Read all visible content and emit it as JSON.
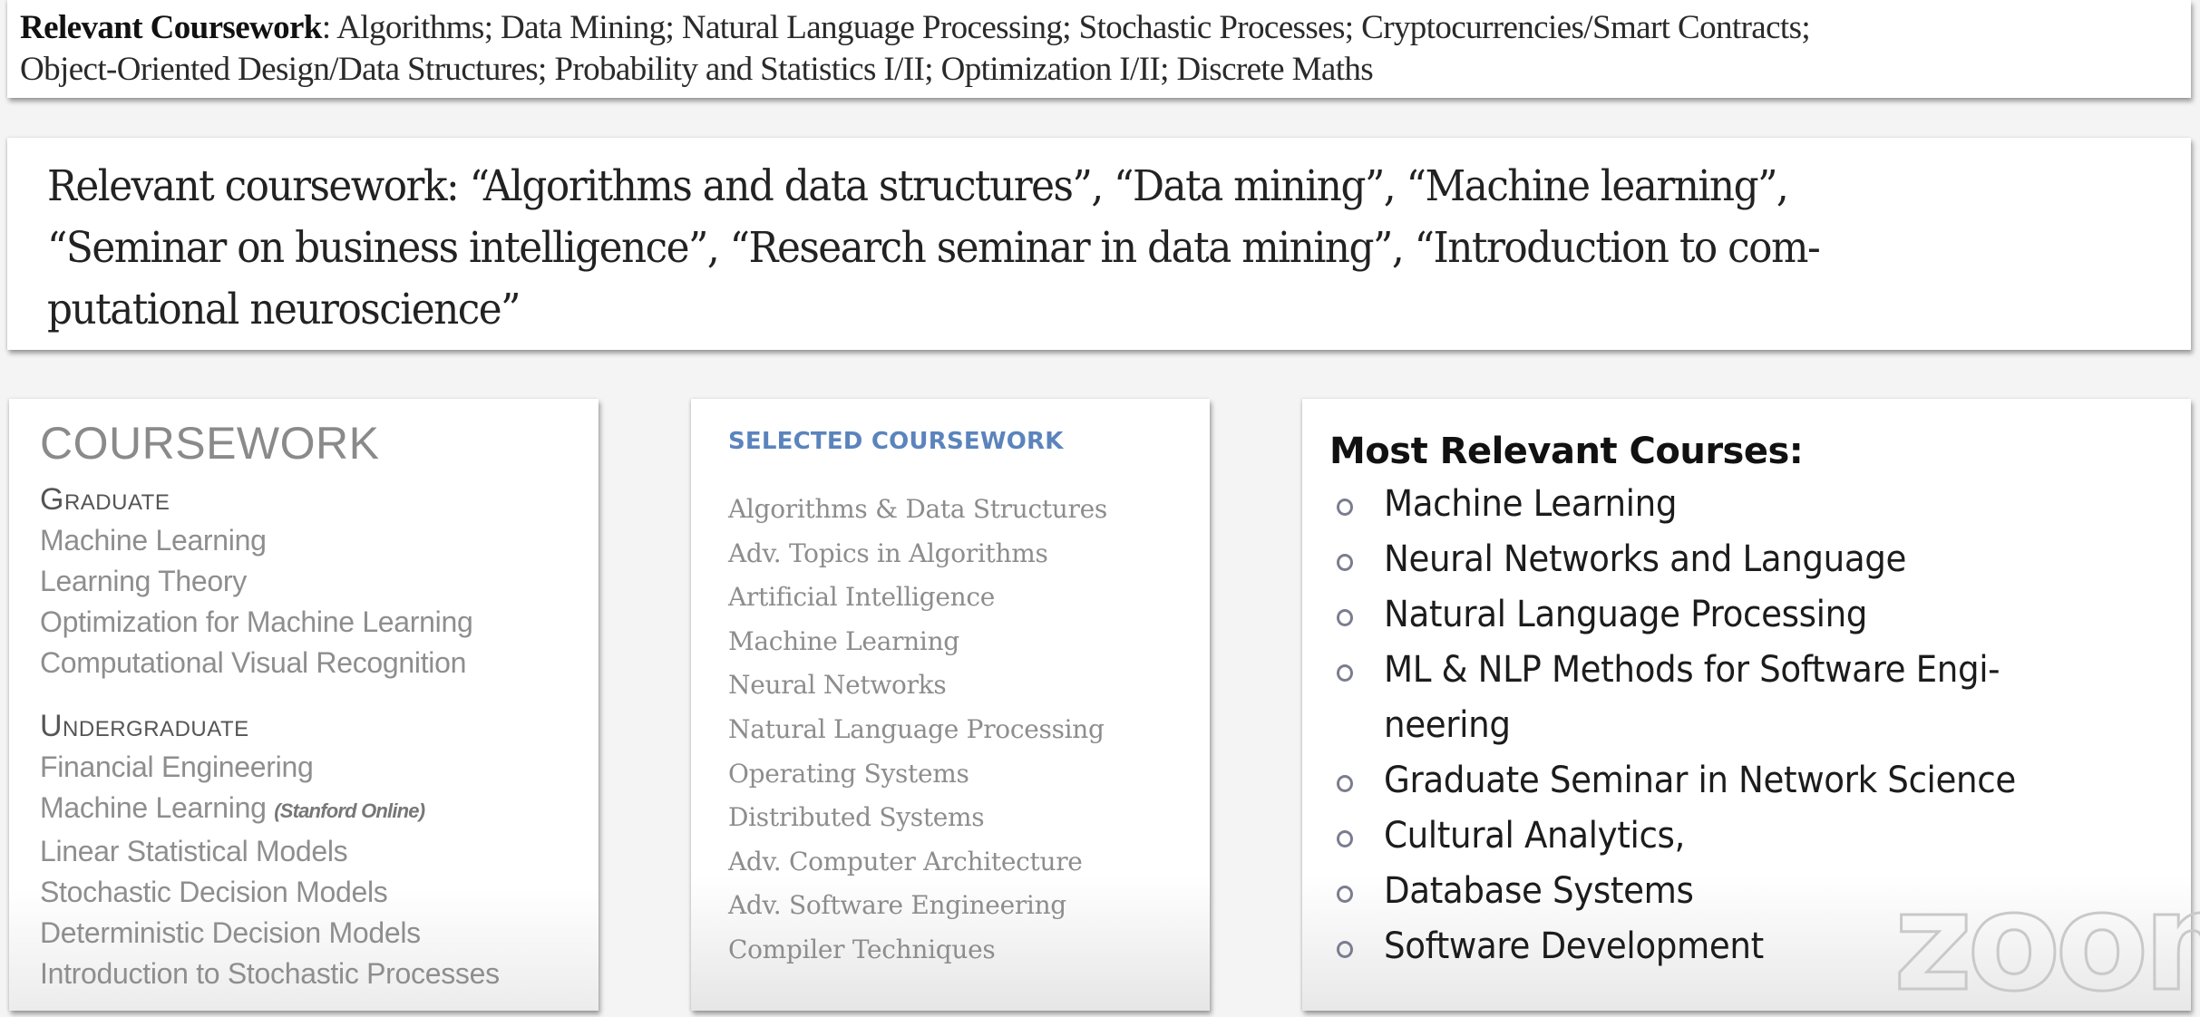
{
  "card_1": {
    "lead": "Relevant Coursework",
    "line_1_rest": ": Algorithms; Data Mining; Natural Language Processing; Stochastic Processes; Cryptocurrencies/Smart Contracts;",
    "line_2": "Object-Oriented Design/Data Structures; Probability and Statistics I/II; Optimization I/II; Discrete Maths"
  },
  "card_2": {
    "lines": [
      "Relevant coursework:  “Algorithms and data structures”, “Data mining”, “Machine learning”,",
      "“Seminar on business intelligence”, “Research seminar in data mining”, “Introduction to com-",
      "putational neuroscience”"
    ]
  },
  "card_3": {
    "title": "COURSEWORK",
    "graduate_heading": "Graduate",
    "graduate_items": [
      "Machine Learning",
      "Learning Theory",
      "Optimization for Machine Learning",
      "Computational Visual Recognition"
    ],
    "undergraduate_heading": "Undergraduate",
    "undergraduate_items": [
      "Financial Engineering",
      "Machine Learning",
      "Linear Statistical Models",
      "Stochastic Decision Models",
      "Deterministic Decision Models",
      "Introduction to Stochastic Processes"
    ],
    "undergraduate_note": "(Stanford Online)"
  },
  "card_4": {
    "title": "SELECTED COURSEWORK",
    "title_color": "#5b84bd",
    "items": [
      "Algorithms & Data Structures",
      "Adv. Topics in Algorithms",
      "Artificial Intelligence",
      "Machine Learning",
      "Neural Networks",
      "Natural Language Processing",
      "Operating Systems",
      "Distributed Systems",
      "Adv. Computer Architecture",
      "Adv. Software Engineering",
      "Compiler Techniques"
    ]
  },
  "card_5": {
    "title": "Most Relevant Courses:",
    "bullet_icon": "hollow-circle-bullet",
    "items": [
      "Machine Learning",
      "Neural Networks and Language",
      "Natural Language Processing",
      "ML & NLP Methods for Software Engi- neering",
      "Graduate Seminar in Network Science",
      "Cultural Analytics,",
      "Database Systems",
      "Software Development"
    ],
    "wrapped_item_lines": [
      "ML & NLP Methods for Software Engi-",
      "neering"
    ]
  },
  "watermark": {
    "text": "zoom",
    "icon": "zoom-logo-watermark"
  }
}
